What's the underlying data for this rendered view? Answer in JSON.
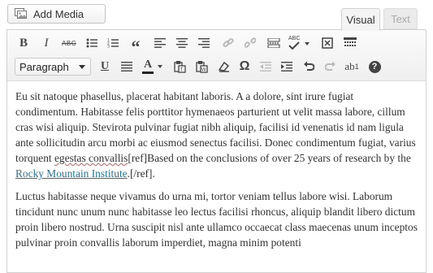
{
  "media": {
    "add_media_label": "Add Media"
  },
  "tabs": {
    "visual": "Visual",
    "text": "Text"
  },
  "toolbar": {
    "format_select_value": "Paragraph",
    "row1_icons": [
      "bold-icon",
      "italic-icon",
      "strikethrough-icon",
      "bullet-list-icon",
      "numbered-list-icon",
      "blockquote-icon",
      "align-left-icon",
      "align-center-icon",
      "align-right-icon",
      "insert-link-icon",
      "remove-link-icon",
      "insert-more-icon",
      "spellcheck-icon",
      "fullscreen-icon",
      "toolbar-toggle-icon"
    ],
    "row2_icons": [
      "underline-icon",
      "justify-icon",
      "text-color-icon",
      "paste-as-text-icon",
      "paste-from-word-icon",
      "clear-formatting-icon",
      "special-character-icon",
      "outdent-icon",
      "indent-icon",
      "undo-icon",
      "redo-icon",
      "superscript-icon",
      "help-icon"
    ],
    "bold_glyph": "B",
    "italic_glyph": "I",
    "strike_glyph": "ABC",
    "quote_glyph": "“",
    "spell_glyph": "ABC",
    "underline_glyph": "U",
    "color_glyph": "A",
    "special_char_glyph": "Ω",
    "superscript_base": "ab",
    "superscript_exp": "1",
    "help_glyph": "?"
  },
  "content": {
    "p1_part1": "Eu sit natoque phasellus, placerat habitant laboris. A a dolore, sint irure fugiat condimentum. Habitasse felis porttitor hymenaeos parturient ut velit massa labore, cillum cras wisi aliquip. Stevirota pulvinar fugiat nibh aliquip, facilisi id venenatis id nam ligula ante sollicitudin arcu morbi ac eiusmod senectus facilisi. Donec condimentum fugiat, varius torquent ",
    "p1_spell": "egestas convallis",
    "p1_part2": "[ref]Based on the conclusions of over 25 years of research by the ",
    "p1_link": "Rocky Mountain Institute",
    "p1_part3": ".[/ref].",
    "p2": "Luctus habitasse neque vivamus do urna mi, tortor veniam tellus labore wisi. Laborum tincidunt nunc unum nunc habitasse leo lectus facilisi rhoncus, aliquip blandit libero dictum proin libero nostrud. Urna suscipit nisl ante ullamco occaecat class maecenas unum inceptos pulvinar proin convallis laborum imperdiet, magna minim potenti"
  },
  "colors": {
    "link": "#21759b",
    "spellcheck_underline": "#e05050",
    "toolbar_bg": "#f4f4f4"
  }
}
